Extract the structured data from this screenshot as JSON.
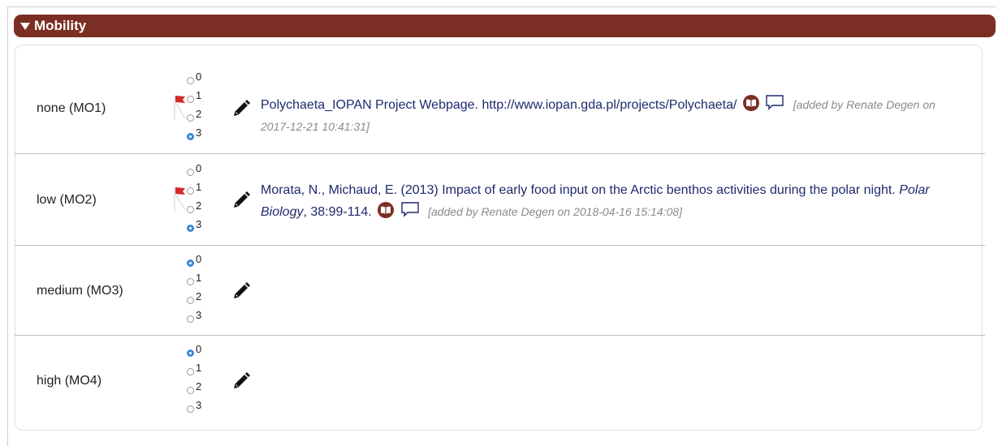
{
  "section": {
    "title": "Mobility"
  },
  "colors": {
    "header_bg": "#7b2e24",
    "radio_checked": "#3e86d8",
    "flag": "#d42a2a",
    "link": "#1f2a6b"
  },
  "rows": [
    {
      "label": "none (MO1)",
      "selected": "3",
      "flagged": true,
      "radio_labels": [
        "0",
        "1",
        "2",
        "3"
      ],
      "reference": {
        "text": "Polychaeta_IOPAN Project Webpage. http://www.iopan.gda.pl/projects/Polychaeta/",
        "journal": "",
        "tail": "",
        "added_by": "[added by Renate Degen on 2017-12-21 10:41:31]"
      }
    },
    {
      "label": "low (MO2)",
      "selected": "3",
      "flagged": true,
      "radio_labels": [
        "0",
        "1",
        "2",
        "3"
      ],
      "reference": {
        "text": "Morata, N., Michaud, E. (2013) Impact of early food input on the Arctic benthos activities during the polar night. ",
        "journal": "Polar Biology",
        "tail": ", 38:99-114.",
        "added_by": "[added by Renate Degen on 2018-04-16 15:14:08]"
      }
    },
    {
      "label": "medium (MO3)",
      "selected": "0",
      "flagged": false,
      "radio_labels": [
        "0",
        "1",
        "2",
        "3"
      ]
    },
    {
      "label": "high (MO4)",
      "selected": "0",
      "flagged": false,
      "radio_labels": [
        "0",
        "1",
        "2",
        "3"
      ]
    }
  ],
  "icons": {
    "edit": "pencil-icon",
    "reference": "book-icon",
    "comment": "speech-bubble-icon",
    "flag": "flag-icon",
    "collapse": "triangle-down-icon"
  }
}
